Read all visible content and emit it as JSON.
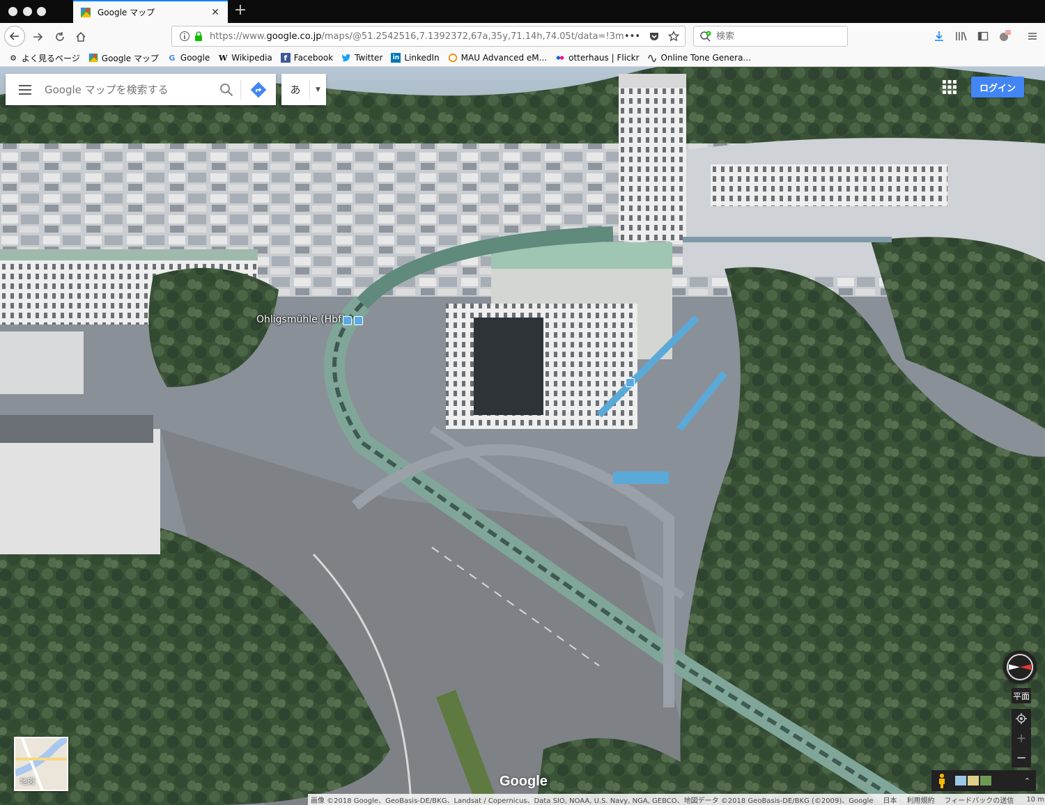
{
  "browser": {
    "tab_title": "Google マップ",
    "url_prefix": "https://www.",
    "url_host": "google.co.jp",
    "url_path": "/maps/@51.2542516,7.1392372,67a,35y,71.14h,74.05t/data=!3m1",
    "search_placeholder": "検索",
    "overflow_label": "•••"
  },
  "bookmarks": [
    {
      "label": "よく見るページ",
      "icon": "gear-icon"
    },
    {
      "label": "Google マップ",
      "icon": "google-maps-icon"
    },
    {
      "label": "Google",
      "icon": "google-icon"
    },
    {
      "label": "Wikipedia",
      "icon": "wikipedia-icon"
    },
    {
      "label": "Facebook",
      "icon": "facebook-icon"
    },
    {
      "label": "Twitter",
      "icon": "twitter-icon"
    },
    {
      "label": "LinkedIn",
      "icon": "linkedin-icon"
    },
    {
      "label": "MAU Advanced eM...",
      "icon": "ring-icon"
    },
    {
      "label": "otterhaus | Flickr",
      "icon": "flickr-icon"
    },
    {
      "label": "Online Tone Genera...",
      "icon": "wave-icon"
    }
  ],
  "maps": {
    "search_placeholder": "Google マップを検索する",
    "ime_label": "あ",
    "login_label": "ログイン",
    "poi_label": "Ohligsmühle (Hbf)",
    "minimap_label": "地図",
    "flat_label": "平面",
    "zoom_in": "+",
    "zoom_out": "−",
    "logo": "Google",
    "attribution": [
      "画像 ©2018 Google、GeoBasis-DE/BKG、Landsat / Copernicus、Data SIO, NOAA, U.S. Navy, NGA, GEBCO、地図データ ©2018 GeoBasis-DE/BKG (©2009)、Google",
      "日本",
      "利用規約",
      "フィードバックの送信"
    ],
    "scale_label": "10 m"
  },
  "colors": {
    "accent": "#4285f4",
    "tab_highlight": "#0a84ff",
    "poi": "#5aa9e6"
  }
}
